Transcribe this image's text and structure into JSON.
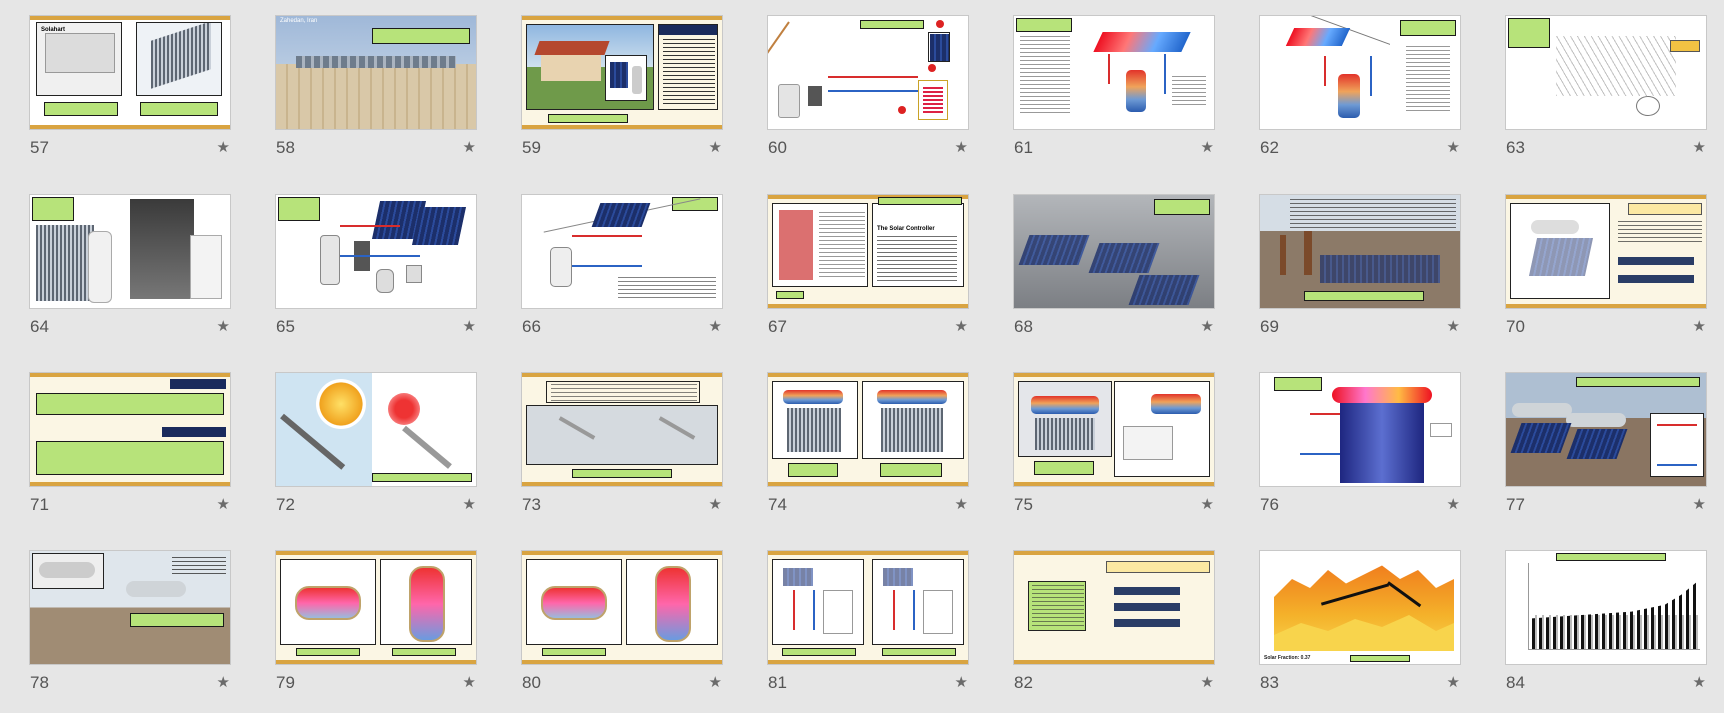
{
  "view": "slide-sorter",
  "colors": {
    "background": "#e6e6e6",
    "accent_bar": "#d9a441",
    "label_green": "#b7e37a",
    "slide_number": "#555555"
  },
  "slides": [
    {
      "number": "57",
      "thumb_text": "Solahart"
    },
    {
      "number": "58",
      "thumb_text": "Zahedan, Iran"
    },
    {
      "number": "59",
      "thumb_text": ""
    },
    {
      "number": "60",
      "thumb_text": ""
    },
    {
      "number": "61",
      "thumb_text": ""
    },
    {
      "number": "62",
      "thumb_text": ""
    },
    {
      "number": "63",
      "thumb_text": ""
    },
    {
      "number": "64",
      "thumb_text": ""
    },
    {
      "number": "65",
      "thumb_text": ""
    },
    {
      "number": "66",
      "thumb_text": ""
    },
    {
      "number": "67",
      "thumb_text": "The Solar Controller"
    },
    {
      "number": "68",
      "thumb_text": ""
    },
    {
      "number": "69",
      "thumb_text": ""
    },
    {
      "number": "70",
      "thumb_text": ""
    },
    {
      "number": "71",
      "thumb_text": ""
    },
    {
      "number": "72",
      "thumb_text": ""
    },
    {
      "number": "73",
      "thumb_text": ""
    },
    {
      "number": "74",
      "thumb_text": ""
    },
    {
      "number": "75",
      "thumb_text": ""
    },
    {
      "number": "76",
      "thumb_text": ""
    },
    {
      "number": "77",
      "thumb_text": ""
    },
    {
      "number": "78",
      "thumb_text": ""
    },
    {
      "number": "79",
      "thumb_text": ""
    },
    {
      "number": "80",
      "thumb_text": ""
    },
    {
      "number": "81",
      "thumb_text": ""
    },
    {
      "number": "82",
      "thumb_text": ""
    },
    {
      "number": "83",
      "thumb_text": "Solar Fraction: 0.37"
    },
    {
      "number": "84",
      "thumb_text": ""
    }
  ],
  "star_icon": "star-icon",
  "star_glyph": "★"
}
